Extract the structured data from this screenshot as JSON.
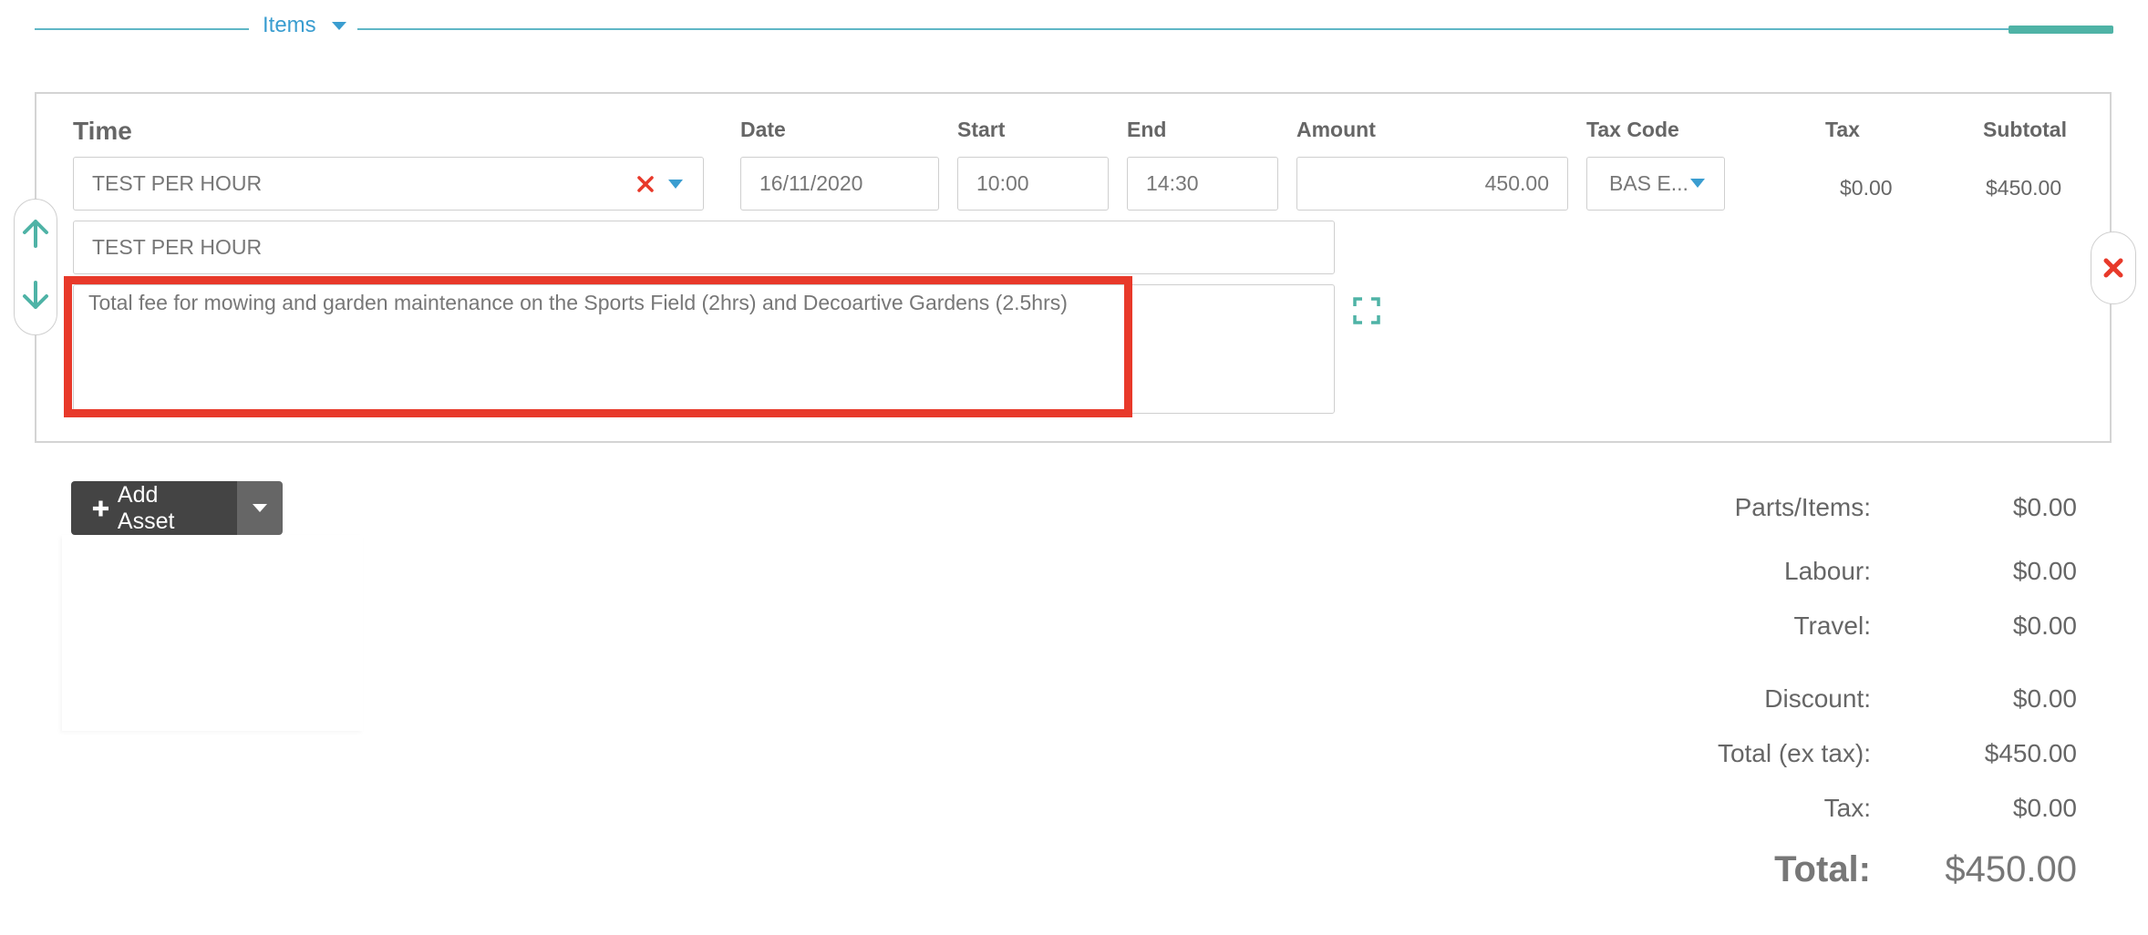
{
  "section": {
    "title": "Items"
  },
  "item": {
    "column_labels": {
      "type": "Time",
      "date": "Date",
      "start": "Start",
      "end": "End",
      "amount": "Amount",
      "tax_code": "Tax Code",
      "tax": "Tax",
      "subtotal": "Subtotal"
    },
    "type_value": "TEST PER HOUR",
    "date_value": "16/11/2020",
    "start_value": "10:00",
    "end_value": "14:30",
    "amount_value": "450.00",
    "tax_code_value": "BAS E...",
    "tax_value": "$0.00",
    "subtotal_value": "$450.00",
    "name_value": "TEST PER HOUR",
    "description_value": "Total fee for mowing and garden maintenance on the Sports Field (2hrs) and Decoartive Gardens (2.5hrs)"
  },
  "add_asset": {
    "label": "Add Asset"
  },
  "summary": {
    "parts_label": "Parts/Items:",
    "parts_value": "$0.00",
    "labour_label": "Labour:",
    "labour_value": "$0.00",
    "travel_label": "Travel:",
    "travel_value": "$0.00",
    "discount_label": "Discount:",
    "discount_value": "$0.00",
    "total_ex_tax_label": "Total (ex tax):",
    "total_ex_tax_value": "$450.00",
    "tax_label": "Tax:",
    "tax_value": "$0.00",
    "total_label": "Total:",
    "total_value": "$450.00"
  },
  "colors": {
    "accent_teal": "#4fb3a6",
    "link_blue": "#3a9dd0",
    "remove_red": "#e8392a",
    "highlight_red": "#e8392a"
  },
  "icons": {
    "move_up": "arrow-up-icon",
    "move_down": "arrow-down-icon",
    "clear": "clear-x-icon",
    "remove": "remove-x-icon",
    "expand": "expand-icon",
    "plus": "plus-icon"
  }
}
